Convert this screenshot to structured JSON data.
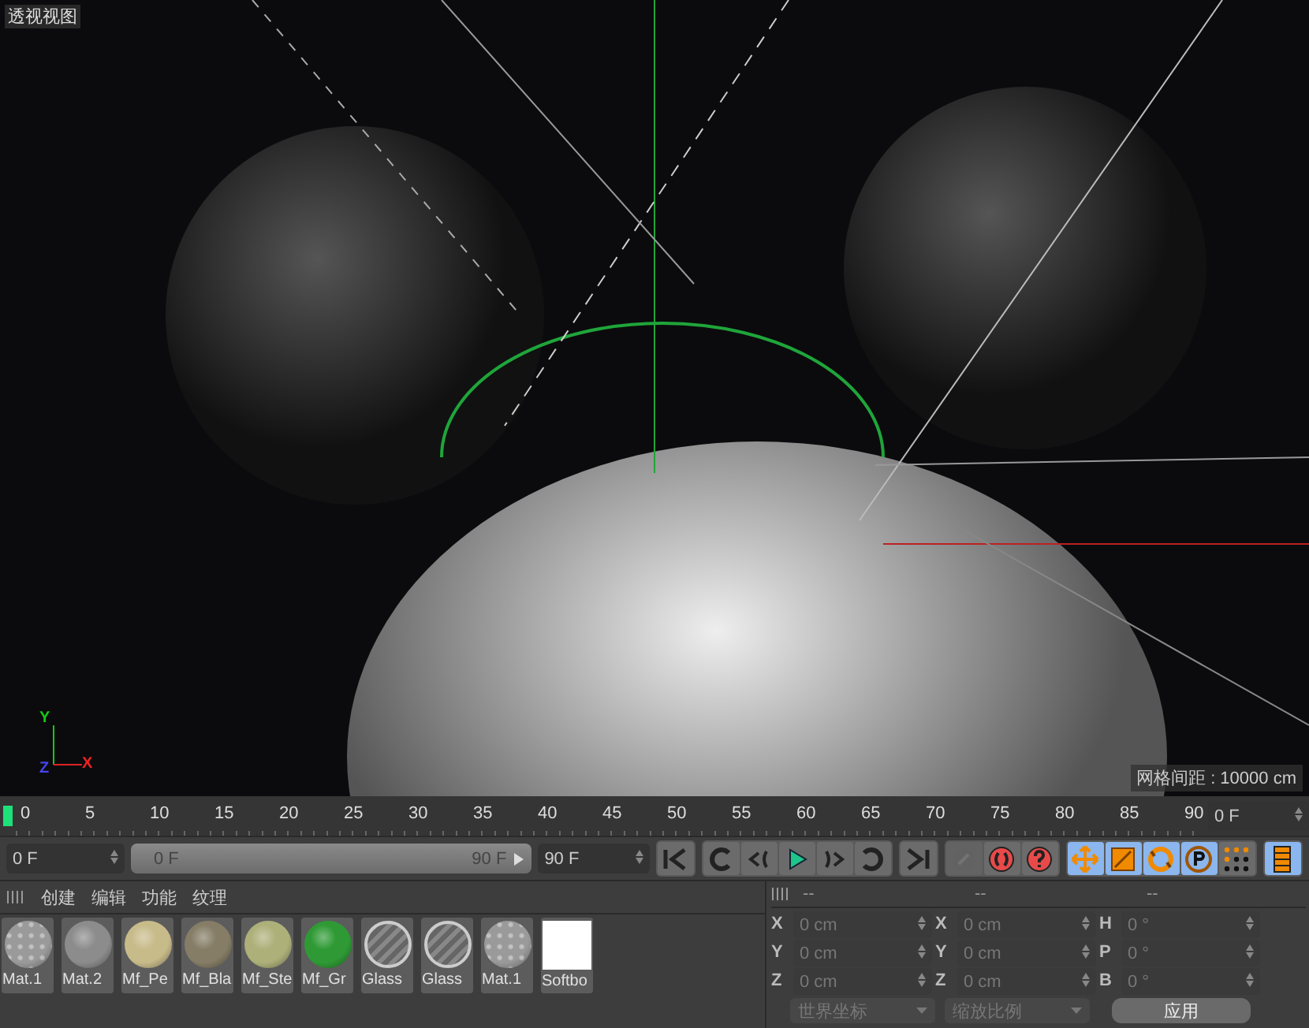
{
  "viewport": {
    "title": "透视视图",
    "grid_label": "网格间距 : 10000 cm",
    "axes": [
      "Y",
      "X",
      "Z"
    ]
  },
  "timeline": {
    "ticks": [
      "0",
      "5",
      "10",
      "15",
      "20",
      "25",
      "30",
      "35",
      "40",
      "45",
      "50",
      "55",
      "60",
      "65",
      "70",
      "75",
      "80",
      "85",
      "90"
    ],
    "level": 0,
    "current_field": "0 F"
  },
  "transport": {
    "start_field": "0 F",
    "range": {
      "start": "0 F",
      "end": "90 F",
      "level": 1
    },
    "end_field": "90 F",
    "groups": [
      [
        {
          "kind": "first"
        }
      ],
      [
        {
          "kind": "loop-back"
        },
        {
          "kind": "step-back"
        },
        {
          "kind": "play"
        },
        {
          "kind": "step-forward"
        },
        {
          "kind": "loop-forward"
        }
      ],
      [
        {
          "kind": "last"
        }
      ],
      [
        {
          "kind": "keyframe",
          "disabled": true
        },
        {
          "kind": "record",
          "disabled": false
        },
        {
          "kind": "help",
          "disabled": false
        }
      ],
      [
        {
          "kind": "move",
          "on": true
        },
        {
          "kind": "scale",
          "on": true
        },
        {
          "kind": "rotate",
          "on": true
        },
        {
          "kind": "param",
          "on": true
        },
        {
          "kind": "grid",
          "on": false
        }
      ],
      [
        {
          "kind": "film",
          "on": true
        }
      ]
    ]
  },
  "materials": {
    "menu": [
      "创建",
      "编辑",
      "功能",
      "纹理"
    ],
    "items": [
      {
        "name": "Mat.1",
        "kind": "rough",
        "color": "#9a9a9a"
      },
      {
        "name": "Mat.2",
        "kind": "sphere",
        "color": "#8c8c8c"
      },
      {
        "name": "Mf_Pe",
        "kind": "sphere",
        "color": "#c8bb8a"
      },
      {
        "name": "Mf_Bla",
        "kind": "sphere",
        "color": "#857d66"
      },
      {
        "name": "Mf_Ste",
        "kind": "sphere",
        "color": "#aeb07a"
      },
      {
        "name": "Mf_Gr",
        "kind": "sphere",
        "color": "#2f9a35"
      },
      {
        "name": "Glass",
        "kind": "glass",
        "color": "#cccccc"
      },
      {
        "name": "Glass",
        "kind": "glass",
        "color": "#cccccc"
      },
      {
        "name": "Mat.1",
        "kind": "rough",
        "color": "#9a9a9a"
      },
      {
        "name": "Softbo",
        "kind": "flat",
        "color": "#ffffff"
      }
    ]
  },
  "coordinates": {
    "headers": [
      "--",
      "--",
      "--"
    ],
    "rows": [
      [
        {
          "label": "X",
          "value": "0 cm"
        },
        {
          "label": "X",
          "value": "0 cm"
        },
        {
          "label": "H",
          "value": "0 °"
        }
      ],
      [
        {
          "label": "Y",
          "value": "0 cm"
        },
        {
          "label": "Y",
          "value": "0 cm"
        },
        {
          "label": "P",
          "value": "0 °"
        }
      ],
      [
        {
          "label": "Z",
          "value": "0 cm"
        },
        {
          "label": "Z",
          "value": "0 cm"
        },
        {
          "label": "B",
          "value": "0 °"
        }
      ]
    ],
    "dropdowns": [
      "世界坐标",
      "缩放比例"
    ],
    "apply": "应用"
  }
}
